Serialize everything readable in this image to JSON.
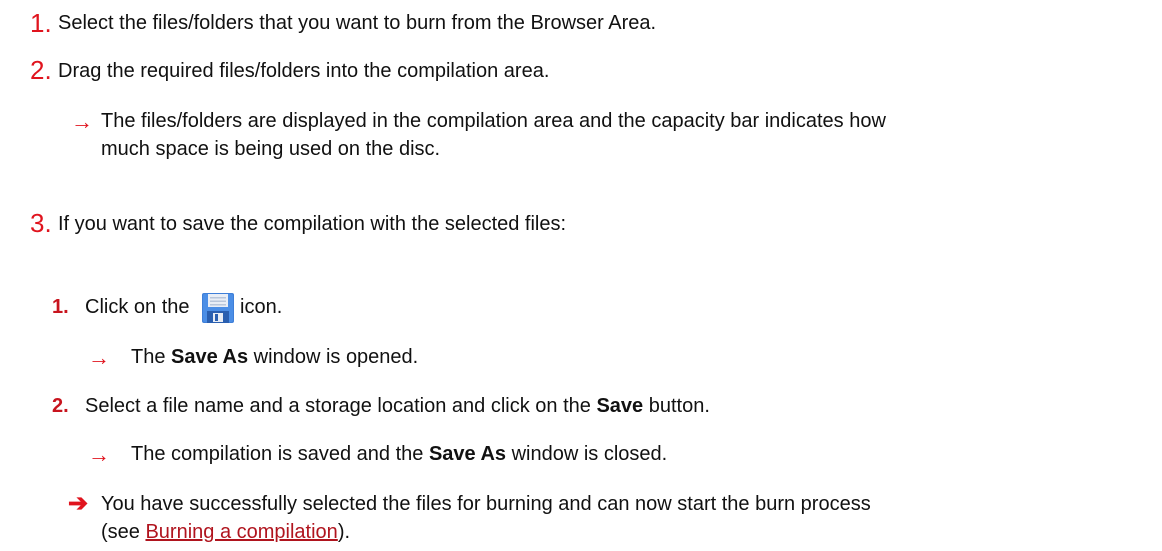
{
  "steps": [
    {
      "num": "1.",
      "text": "Select the files/folders that you want to burn from the Browser Area."
    },
    {
      "num": "2.",
      "text": "Drag the required files/folders into the compilation area."
    },
    {
      "num": "3.",
      "text": "If you want to save the compilation with the selected files:"
    }
  ],
  "step2_result": {
    "arrow": "→",
    "line1": "The files/folders are displayed in the compilation area and the capacity bar indicates how",
    "line2": "much space is being used on the disc."
  },
  "substeps": [
    {
      "num": "1.",
      "text_before": "Click on the",
      "icon": "save-floppy-icon",
      "text_after": "icon.",
      "result_arrow": "→",
      "result_before": "The ",
      "result_bold": "Save As",
      "result_after": " window is opened."
    },
    {
      "num": "2.",
      "text_before": "Select a file name and a storage location and click on the ",
      "text_bold": "Save",
      "text_after": " button.",
      "result_arrow": "→",
      "result_before": "The compilation is saved and the ",
      "result_bold": "Save As",
      "result_after": " window is closed."
    }
  ],
  "final": {
    "arrow": "➔",
    "line1": "You have successfully selected the files for burning and can now start the burn process",
    "line2_before": "(see ",
    "link_text": "Burning a compilation",
    "line2_after": ")."
  },
  "colors": {
    "accent": "#e0141e",
    "link": "#b0141e",
    "text": "#111111"
  }
}
